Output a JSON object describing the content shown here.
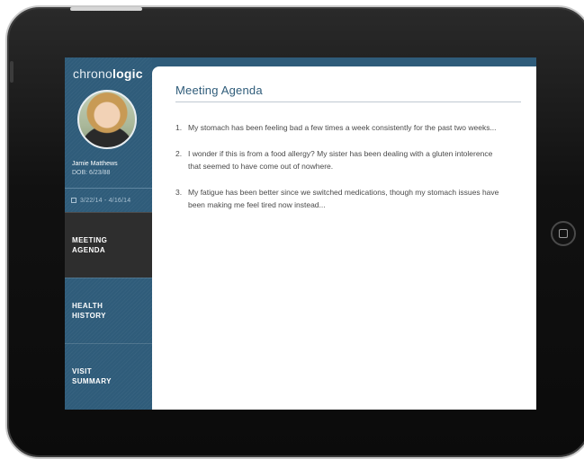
{
  "app": {
    "brand_regular": "chrono",
    "brand_bold": "logic"
  },
  "patient": {
    "name": "Jamie Matthews",
    "dob": "DOB: 6/23/88",
    "date_range": "3/22/14 - 4/16/14"
  },
  "nav": [
    {
      "label": "MEETING\nAGENDA",
      "active": true
    },
    {
      "label": "HEALTH\nHISTORY",
      "active": false
    },
    {
      "label": "VISIT\nSUMMARY",
      "active": false
    }
  ],
  "main": {
    "title": "Meeting Agenda",
    "items": [
      {
        "num": "1.",
        "text": "My stomach has been feeling bad a few times a week consistently for the past two weeks..."
      },
      {
        "num": "2.",
        "text": "I wonder if this is from a food allergy? My sister has been dealing with a gluten intolerence that seemed to have come out of nowhere."
      },
      {
        "num": "3.",
        "text": "My fatigue has been better since we switched medications, though my stomach issues have been making me feel tired now instead..."
      }
    ]
  },
  "colors": {
    "sidebar": "#2f5c7a",
    "active_nav": "#2e2e2e",
    "title": "#2f5c7a"
  }
}
